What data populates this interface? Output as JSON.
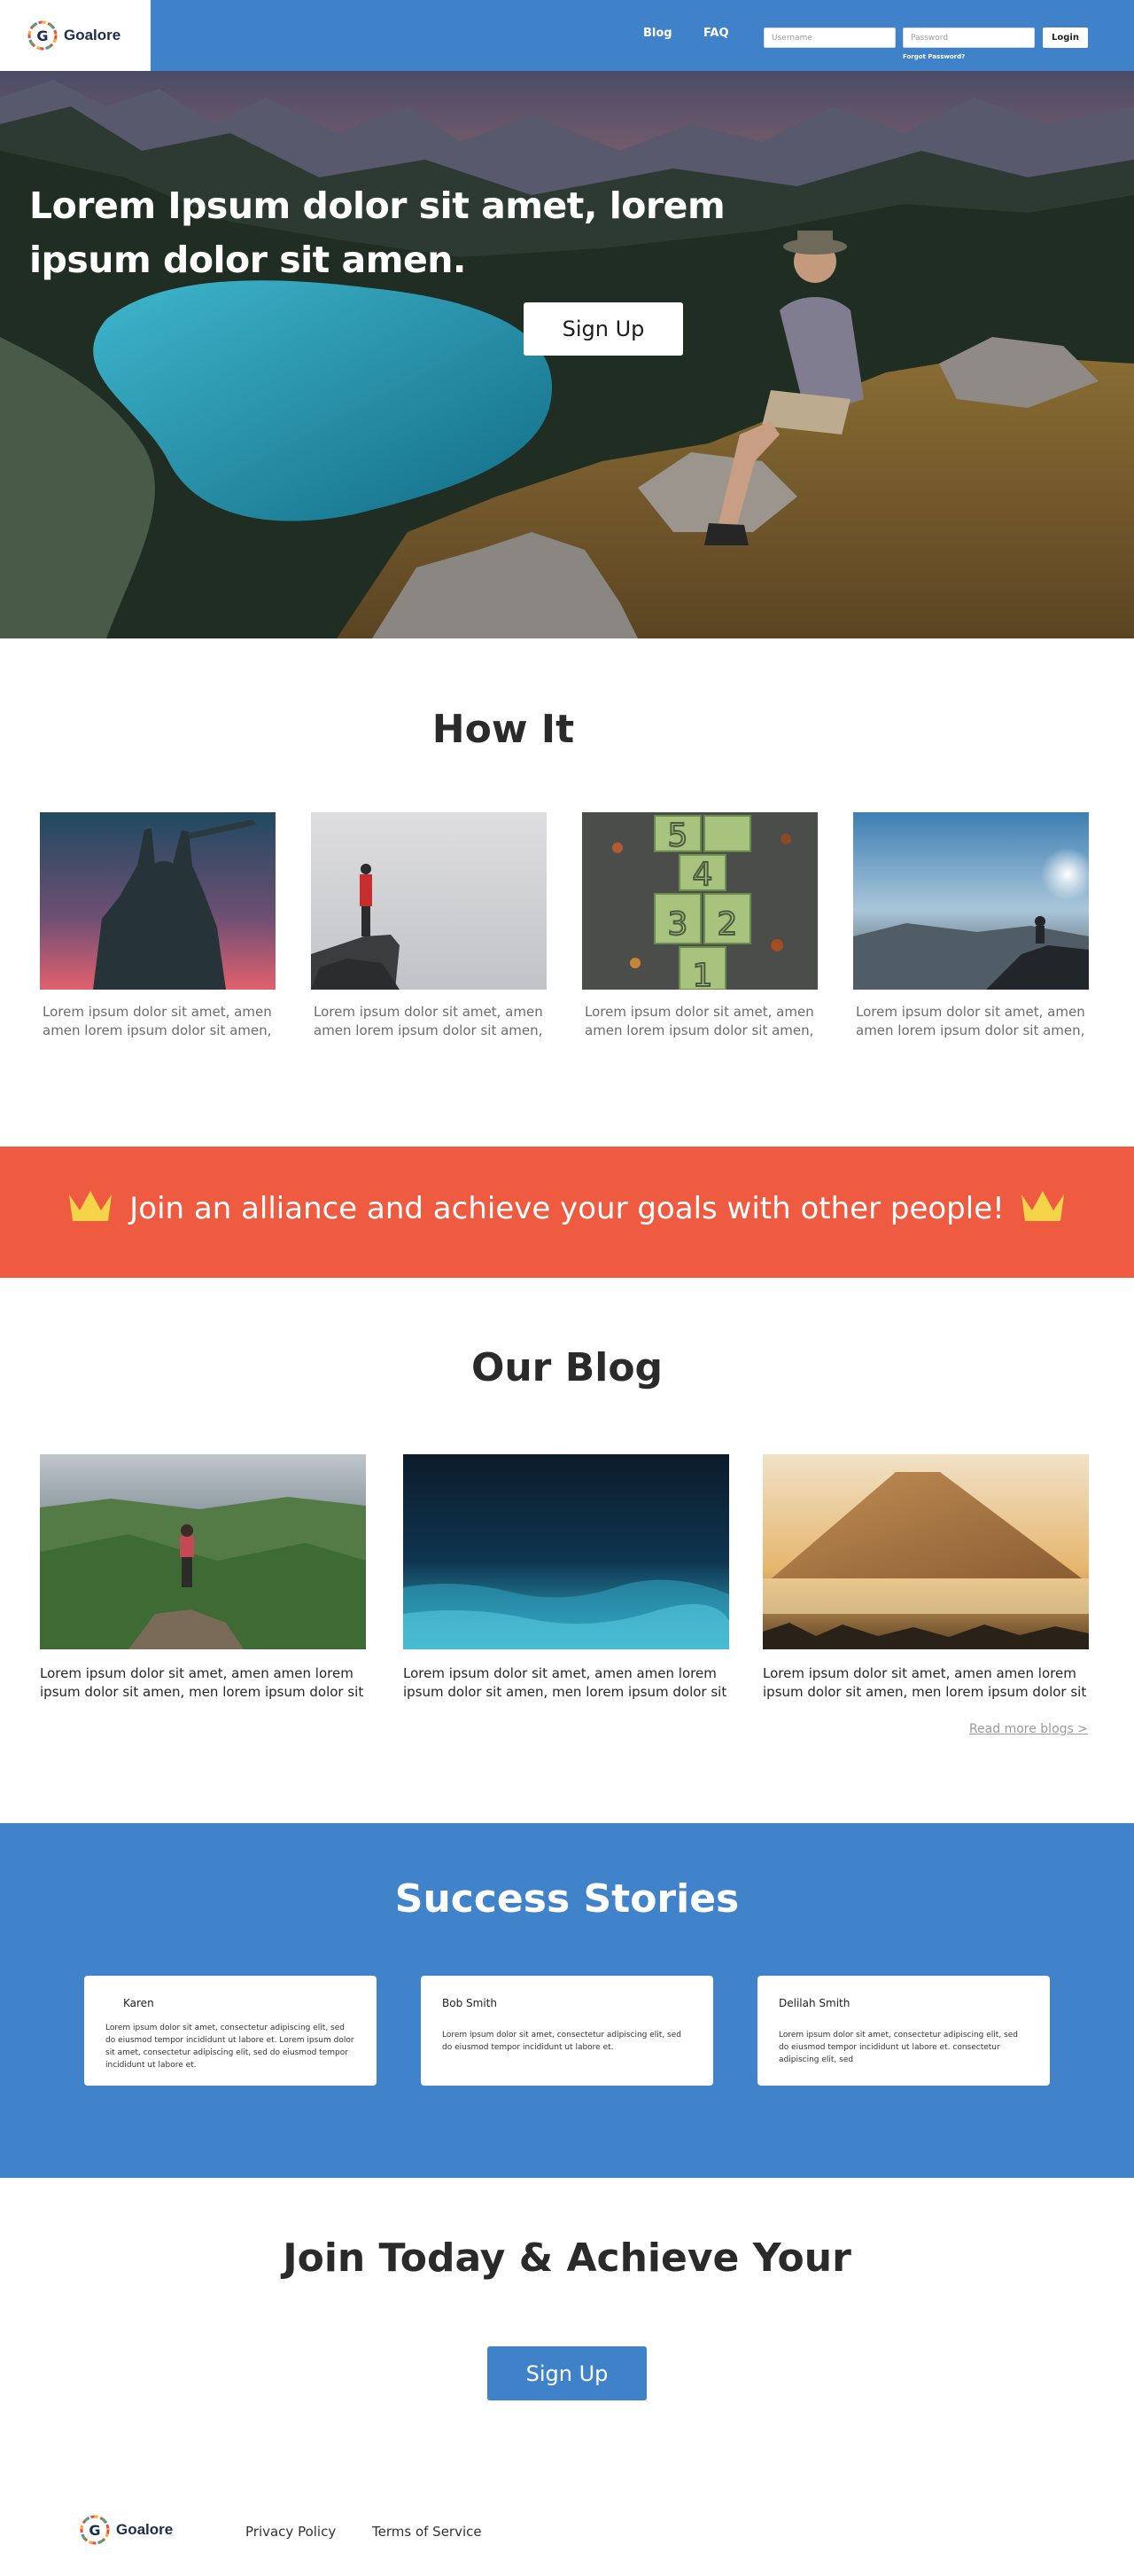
{
  "brand": {
    "name": "Goalore"
  },
  "header": {
    "nav": [
      {
        "label": "Blog"
      },
      {
        "label": "FAQ"
      }
    ],
    "username_placeholder": "Username",
    "password_placeholder": "Password",
    "login_label": "Login",
    "forgot_label": "Forgot Password?"
  },
  "hero": {
    "title": "Lorem Ipsum dolor sit amet, lorem ipsum dolor sit amen.",
    "cta_label": "Sign Up"
  },
  "how_it": {
    "title": "How It",
    "cards": [
      {
        "text": "Lorem ipsum dolor sit amet, amen amen lorem ipsum dolor sit amen,"
      },
      {
        "text": "Lorem ipsum dolor sit amet, amen amen lorem ipsum dolor sit amen,"
      },
      {
        "text": "Lorem ipsum dolor sit amet, amen amen lorem ipsum dolor sit amen,"
      },
      {
        "text": "Lorem ipsum dolor sit amet, amen amen lorem ipsum dolor sit amen,"
      }
    ]
  },
  "banner": {
    "text": "Join an alliance and achieve your goals with other people!",
    "icon": "crown-icon",
    "color": "#ee5b40"
  },
  "blog": {
    "title": "Our Blog",
    "posts": [
      {
        "text": "Lorem ipsum dolor sit amet, amen amen lorem ipsum dolor sit amen, men lorem ipsum dolor sit"
      },
      {
        "text": "Lorem ipsum dolor sit amet, amen amen lorem ipsum dolor sit amen, men lorem ipsum dolor sit"
      },
      {
        "text": "Lorem ipsum dolor sit amet, amen amen lorem ipsum dolor sit amen, men lorem ipsum dolor sit"
      }
    ],
    "read_more": "Read more blogs >"
  },
  "stories": {
    "title": "Success Stories",
    "items": [
      {
        "name": "Karen",
        "text": "Lorem ipsum dolor sit amet, consectetur adipiscing elit, sed do eiusmod tempor incididunt ut labore et. Lorem ipsum dolor sit amet, consectetur adipiscing elit, sed do eiusmod tempor incididunt ut labore et."
      },
      {
        "name": "Bob Smith",
        "text": "Lorem ipsum dolor sit amet, consectetur adipiscing elit, sed do eiusmod tempor incididunt ut labore et."
      },
      {
        "name": "Delilah Smith",
        "text": "Lorem ipsum dolor sit amet, consectetur adipiscing elit, sed do eiusmod tempor incididunt ut labore et.  consectetur adipiscing elit, sed"
      }
    ],
    "color": "#4183cb"
  },
  "join": {
    "title": "Join Today & Achieve Your",
    "cta_label": "Sign Up"
  },
  "footer": {
    "links": [
      {
        "label": "Privacy Policy"
      },
      {
        "label": "Terms of Service"
      }
    ]
  },
  "colors": {
    "primary": "#3f82ca",
    "accent": "#ee5b40",
    "crown": "#f5d44a"
  }
}
